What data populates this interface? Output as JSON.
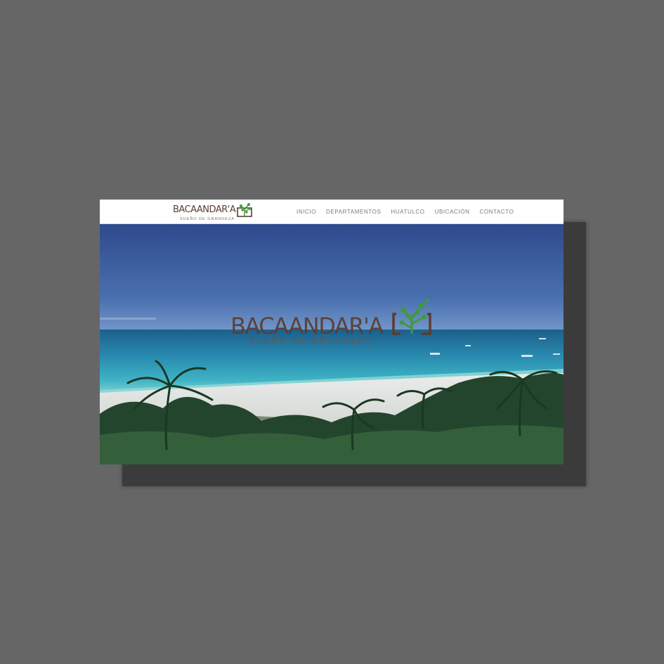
{
  "brand": {
    "name": "BACAANDAR'A",
    "tagline": "SUEÑO DE GRANDEZA"
  },
  "nav": {
    "items": [
      {
        "label": "INICIO"
      },
      {
        "label": "DEPARTAMENTOS"
      },
      {
        "label": "HUATULCO"
      },
      {
        "label": "UBICACIÓN"
      },
      {
        "label": "CONTACTO"
      }
    ]
  },
  "colors": {
    "page_background": "#666666",
    "brand_brown": "#5b3f32",
    "brand_green": "#3f9a3a",
    "nav_text": "#7b7b7b"
  },
  "hero": {
    "image": "aerial beach with palm trees"
  }
}
